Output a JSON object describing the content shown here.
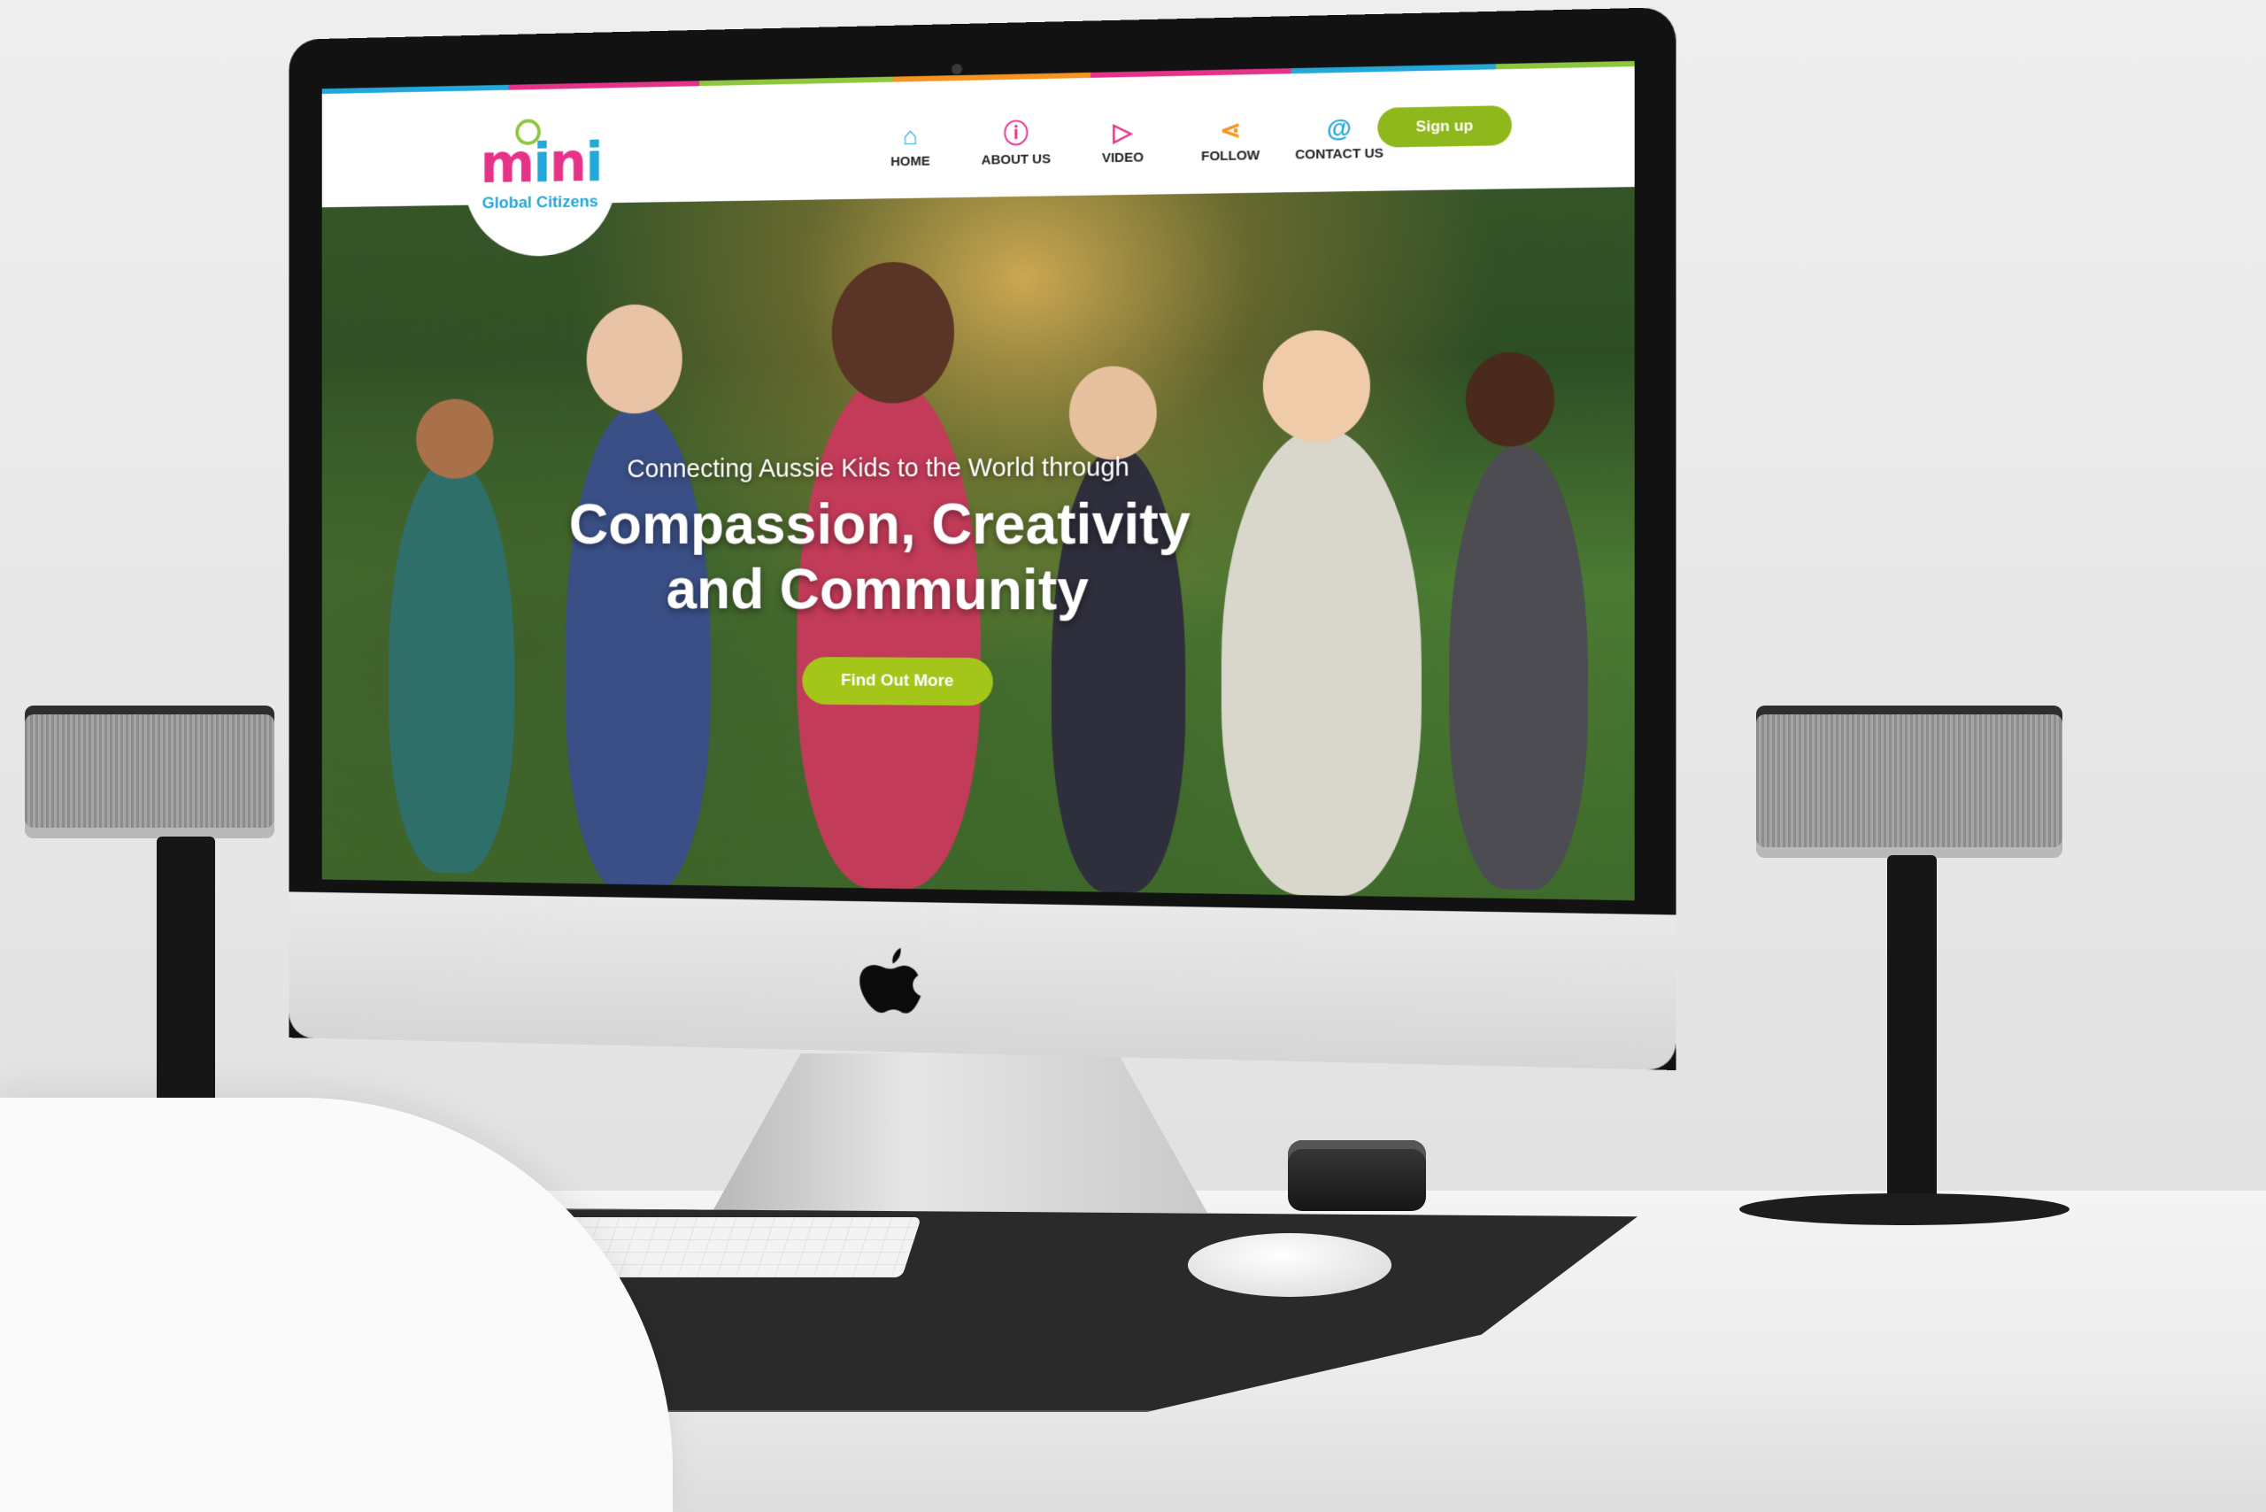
{
  "site": {
    "logo": {
      "word_parts": [
        "m",
        "i",
        "n",
        "i"
      ],
      "subtitle": "Global Citizens"
    },
    "nav": [
      {
        "label": "HOME",
        "icon": "home-icon",
        "glyph": "⌂",
        "color": "#24a7d9"
      },
      {
        "label": "ABOUT US",
        "icon": "info-icon",
        "glyph": "ⓘ",
        "color": "#e6338a"
      },
      {
        "label": "VIDEO",
        "icon": "play-icon",
        "glyph": "▷",
        "color": "#e6338a"
      },
      {
        "label": "FOLLOW",
        "icon": "share-icon",
        "glyph": "⋖",
        "color": "#f7941d"
      },
      {
        "label": "CONTACT US",
        "icon": "at-icon",
        "glyph": "@",
        "color": "#24a7d9"
      }
    ],
    "signup_label": "Sign up",
    "hero": {
      "tagline": "Connecting Aussie Kids to the World through",
      "headline_line1": "Compassion, Creativity",
      "headline_line2": "and Community",
      "cta_label": "Find Out More"
    },
    "colors": {
      "accent_green": "#a4c61a",
      "brand_pink": "#e6338a",
      "brand_blue": "#24a7d9",
      "brand_orange": "#f7941d"
    }
  }
}
